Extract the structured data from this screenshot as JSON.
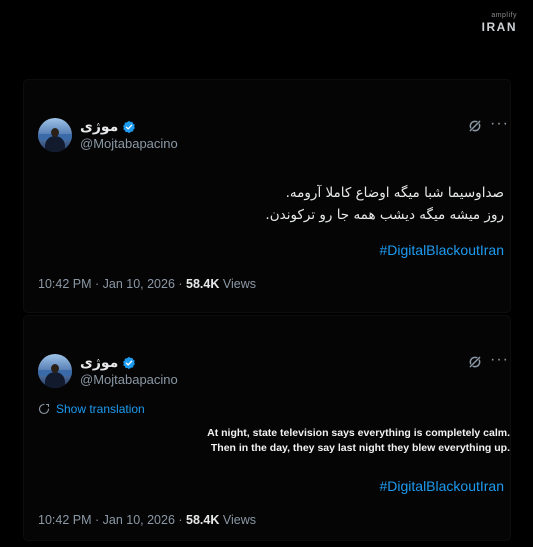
{
  "brand": {
    "small": "amplify",
    "main": "IRAN"
  },
  "tweets": [
    {
      "display_name": "موژی",
      "handle": "@Mojtabapacino",
      "text_lines": [
        "صداوسیما شبا میگه اوضاع کاملا آرومه.",
        "روز میشه میگه دیشب همه جا رو ترکوندن."
      ],
      "hashtag": "#DigitalBlackoutIran",
      "time": "10:42 PM · Jan 10, 2026 · ",
      "views_count": "58.4K",
      "views_label": " Views"
    },
    {
      "display_name": "موژی",
      "handle": "@Mojtabapacino",
      "show_translation": "Show translation",
      "translation_lines": [
        "At night, state television says everything is completely calm.",
        "Then in the day, they say last night they blew everything up."
      ],
      "hashtag": "#DigitalBlackoutIran",
      "time": "10:42 PM · Jan 10, 2026 · ",
      "views_count": "58.4K",
      "views_label": " Views"
    }
  ],
  "icons": {
    "verified": "verified-badge-icon",
    "grok": "grok-icon",
    "more": "more-options-icon",
    "translate": "translate-icon"
  },
  "colors": {
    "accent": "#1d9bf0",
    "muted": "#8b98a5",
    "text": "#e7e9ea",
    "background": "#000000"
  }
}
